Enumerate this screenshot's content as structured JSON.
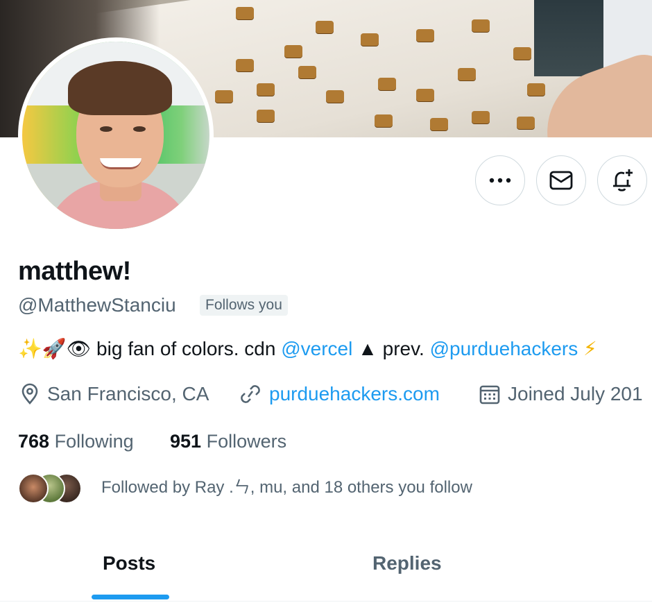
{
  "profile": {
    "display_name": "matthew!",
    "handle": "@MatthewStanciu",
    "follows_you": "Follows you",
    "bio": {
      "emoji_prefix": "✨🚀👁",
      "text1": " big fan of colors. cdn ",
      "mention1": "@vercel",
      "triangle": " ▲ ",
      "text2": "prev. ",
      "mention2": "@purduehackers",
      "emoji_suffix": " ⚡"
    },
    "location": "San Francisco, CA",
    "website": "purduehackers.com",
    "joined": "Joined July 201"
  },
  "stats": {
    "following_count": "768",
    "following_label": "Following",
    "followers_count": "951",
    "followers_label": "Followers"
  },
  "followed_by": "Followed by Ray .ㄣ, mu, and 18 others you follow",
  "tabs": [
    {
      "label": "Posts",
      "active": true
    },
    {
      "label": "Replies",
      "active": false
    }
  ],
  "colors": {
    "accent": "#1d9bf0",
    "secondary_text": "#536471"
  },
  "icons": {
    "more": "more-dots-icon",
    "message": "envelope-icon",
    "notify": "bell-plus-icon",
    "location": "location-pin-icon",
    "link": "link-icon",
    "calendar": "calendar-icon"
  }
}
